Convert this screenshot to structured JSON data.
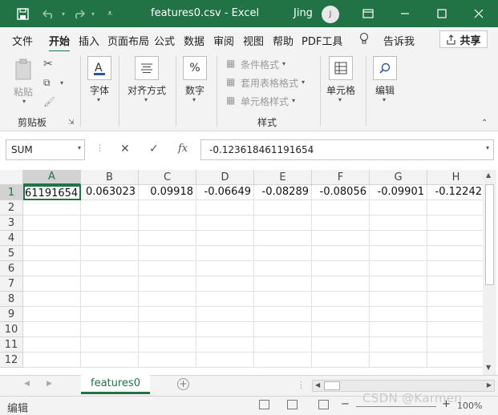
{
  "window": {
    "title": "features0.csv  -  Excel",
    "user": "Jing",
    "avatar_initial": "J"
  },
  "menu": {
    "tabs": [
      "文件",
      "开始",
      "插入",
      "页面布局",
      "公式",
      "数据",
      "审阅",
      "视图",
      "帮助",
      "PDF工具",
      "告诉我"
    ],
    "active": "开始",
    "share": "共享"
  },
  "ribbon": {
    "clipboard": {
      "paste": "粘贴",
      "label": "剪贴板"
    },
    "font": "字体",
    "align": "对齐方式",
    "number": "数字",
    "styles": {
      "conditional": "条件格式",
      "table": "套用表格格式",
      "cell": "单元格样式",
      "label": "样式"
    },
    "cells": "单元格",
    "edit": "编辑",
    "number_glyph": "%"
  },
  "formula": {
    "name_box": "SUM",
    "value": "-0.123618461191654",
    "fx": "fx"
  },
  "grid": {
    "columns": [
      "A",
      "B",
      "C",
      "D",
      "E",
      "F",
      "G",
      "H"
    ],
    "rows": [
      "1",
      "2",
      "3",
      "4",
      "5",
      "6",
      "7",
      "8",
      "9",
      "10",
      "11",
      "12"
    ],
    "row1": [
      "61191654",
      "0.063023",
      "0.09918",
      "-0.06649",
      "-0.08289",
      "-0.08056",
      "-0.09901",
      "-0.12242"
    ]
  },
  "sheets": {
    "active": "features0"
  },
  "status": {
    "mode": "编辑",
    "zoom": "100%"
  },
  "watermark": "CSDN @Karmen"
}
